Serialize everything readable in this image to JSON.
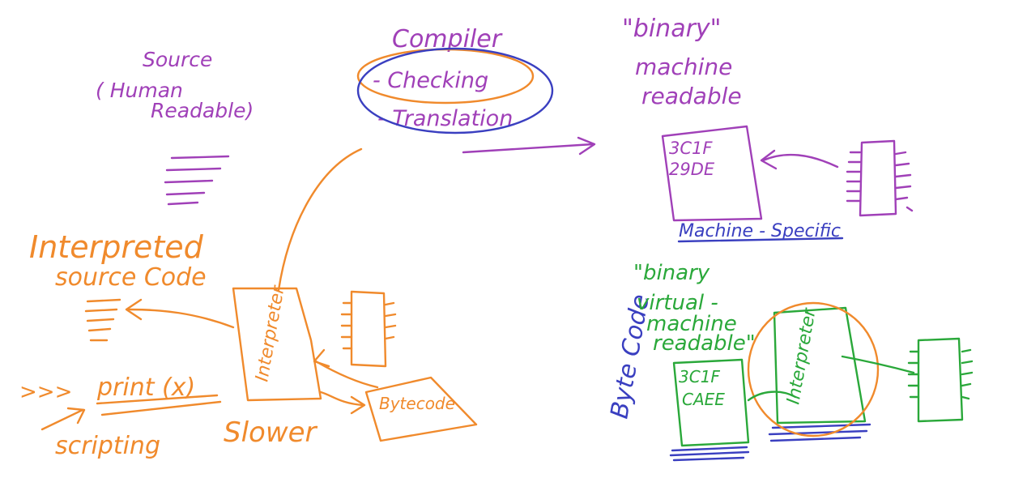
{
  "source": {
    "line1": "Source",
    "line2": "( Human",
    "line3": "Readable)"
  },
  "compiler": {
    "title": "Compiler",
    "item1": "- Checking",
    "item2": "- Translation"
  },
  "binary": {
    "line1": "\"binary\"",
    "line2": "machine",
    "line3": "readable"
  },
  "machine_code": {
    "line1": "3C1F",
    "line2": "29DE",
    "label": "Machine - Specific"
  },
  "interpreted": {
    "line1": "Interpreted",
    "line2": "source Code"
  },
  "prompt": {
    "prefix": ">>>",
    "code": "print (x)"
  },
  "scripting": "scripting",
  "slower": "Slower",
  "interpreter_box": "Interpreter",
  "bytecode_box": "Bytecode",
  "bytecode_side": "Byte Code",
  "vm": {
    "line1": "\"binary",
    "line2": "virtual -",
    "line3": "machine",
    "line4": "readable\""
  },
  "vm_code": {
    "line1": "3C1F",
    "line2": "CAEE"
  },
  "vm_interpreter": "Interpreter",
  "colors": {
    "purple": "#a040b8",
    "orange": "#f08a2c",
    "blue": "#3a3fc0",
    "green": "#2aa83a",
    "background": "#ffffff"
  }
}
